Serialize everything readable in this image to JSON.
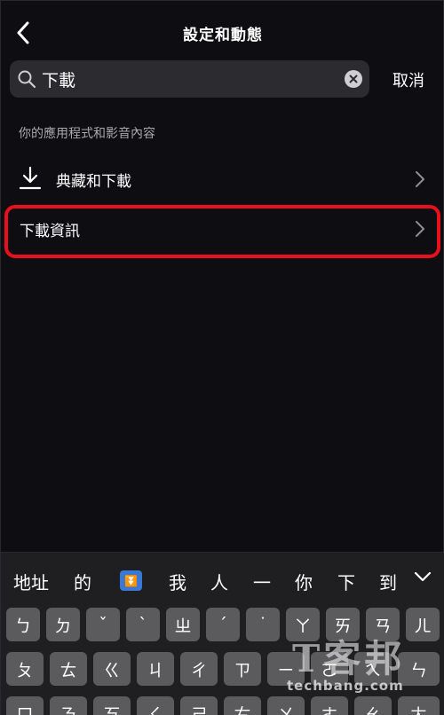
{
  "header": {
    "title": "設定和動態"
  },
  "search": {
    "value": "下載",
    "cancel_label": "取消"
  },
  "section": {
    "label": "你的應用程式和影音內容"
  },
  "rows": [
    {
      "label": "典藏和下載",
      "icon": "download-icon"
    },
    {
      "label": "下載資訊"
    }
  ],
  "keyboard": {
    "candidates": [
      "地址",
      "的",
      "我",
      "人",
      "一",
      "你",
      "下",
      "到"
    ],
    "row1": [
      "ㄅ",
      "ㄉ",
      "ˇ",
      "ˋ",
      "ㄓ",
      "ˊ",
      "˙",
      "ㄚ",
      "ㄞ",
      "ㄢ",
      "ㄦ"
    ],
    "row2": [
      "ㄆ",
      "ㄊ",
      "ㄍ",
      "ㄐ",
      "ㄔ",
      "ㄗ",
      "ㄧ",
      "ㄛ",
      "ㄟ",
      "ㄣ"
    ],
    "row3": [
      "ㄇ",
      "ㄋ",
      "ㄎ",
      "ㄑ",
      "ㄕ",
      "ㄘ",
      "ㄨ",
      "ㄜ",
      "ㄠ",
      "ㄤ"
    ]
  },
  "watermark": {
    "logo": "T客邦",
    "url": "techbang.com"
  },
  "colors": {
    "background": "#0e0e12",
    "highlight": "#e8101c",
    "search_bg": "#2c2c30",
    "key_bg": "#5b5b5e"
  }
}
